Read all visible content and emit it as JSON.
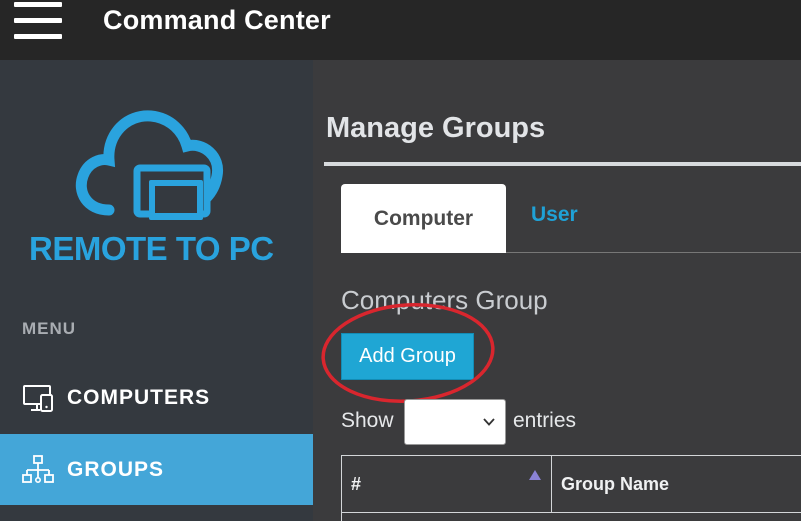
{
  "header": {
    "title": "Command Center",
    "menu_icon": "hamburger-menu-icon"
  },
  "sidebar": {
    "logo_text": "REMOTE TO PC",
    "menu_heading": "MENU",
    "items": [
      {
        "label": "COMPUTERS",
        "icon": "monitor-icon",
        "active": false
      },
      {
        "label": "GROUPS",
        "icon": "network-icon",
        "active": true
      }
    ]
  },
  "main": {
    "page_title": "Manage Groups",
    "tabs": [
      {
        "label": "Computer",
        "active": true
      },
      {
        "label": "User",
        "active": false
      }
    ],
    "section_title": "Computers Group",
    "add_button": "Add Group",
    "length_control": {
      "prefix": "Show",
      "suffix": "entries",
      "selected": ""
    },
    "table": {
      "columns": [
        "#",
        "Group Name"
      ]
    }
  },
  "colors": {
    "topbar": "#262626",
    "sidebar": "#34393f",
    "active_nav": "#44a6d8",
    "accent": "#1fa6d4",
    "highlight_ring": "#d9262e"
  }
}
